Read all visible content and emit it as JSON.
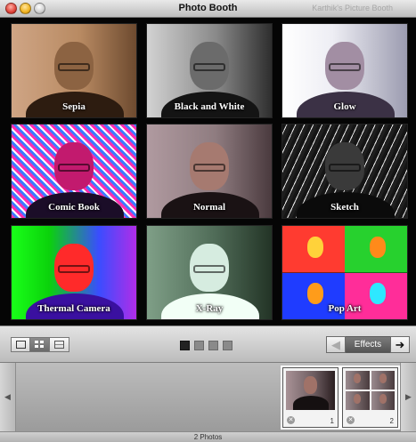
{
  "window": {
    "title": "Photo Booth",
    "subtitle": "Karthik's Picture Booth"
  },
  "effects": [
    {
      "label": "Sepia"
    },
    {
      "label": "Black and White"
    },
    {
      "label": "Glow"
    },
    {
      "label": "Comic Book"
    },
    {
      "label": "Normal"
    },
    {
      "label": "Sketch"
    },
    {
      "label": "Thermal Camera"
    },
    {
      "label": "X-Ray"
    },
    {
      "label": "Pop Art"
    }
  ],
  "toolbar": {
    "view_modes": [
      "single-view-icon",
      "grid-view-icon",
      "strip-view-icon"
    ],
    "selected_view": "grid-view-icon",
    "pages_total": 4,
    "page_current": 1,
    "effects_label": "Effects",
    "prev_icon": "arrow-left-icon",
    "next_icon": "arrow-right-icon"
  },
  "tray": {
    "photos": [
      {
        "number": "1"
      },
      {
        "number": "2"
      }
    ]
  },
  "status": {
    "text": "2 Photos"
  }
}
